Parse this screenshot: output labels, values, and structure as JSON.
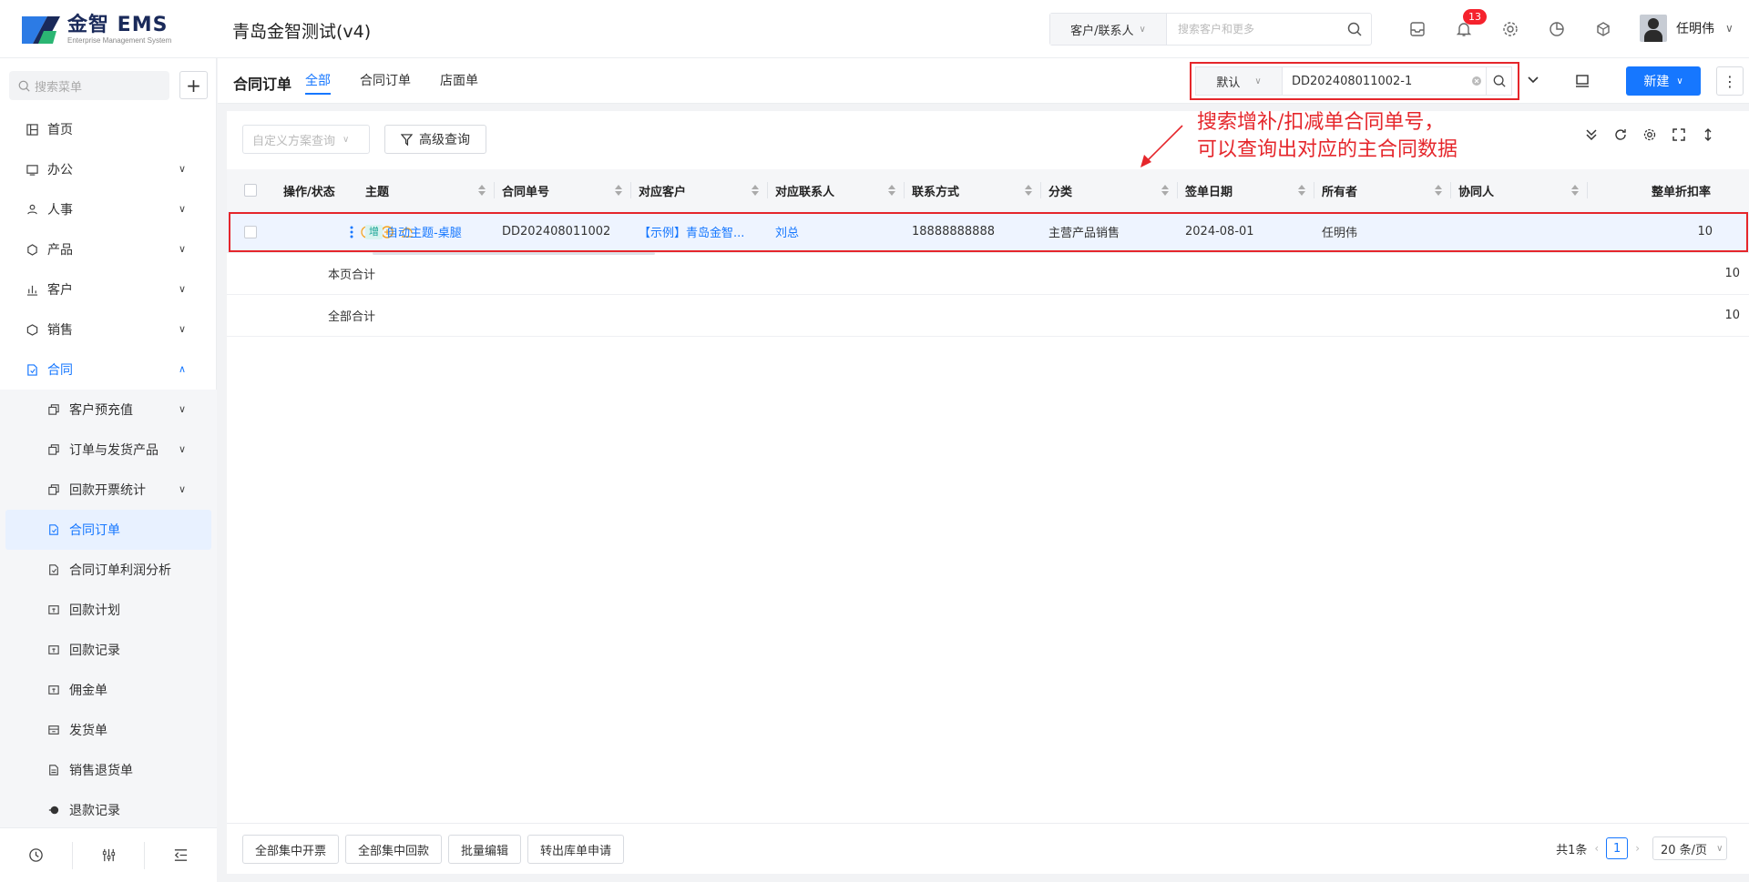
{
  "header": {
    "logo_title": "金智 EMS",
    "logo_subtitle": "Enterprise Management System",
    "app_title": "青岛金智测试(v4)",
    "search_type": "客户/联系人",
    "search_placeholder": "搜索客户和更多",
    "notification_count": "13",
    "user_name": "任明伟"
  },
  "sidebar": {
    "search_placeholder": "搜索菜单",
    "items": [
      {
        "label": "首页",
        "icon": "home-icon"
      },
      {
        "label": "办公",
        "icon": "office-icon"
      },
      {
        "label": "人事",
        "icon": "people-icon"
      },
      {
        "label": "产品",
        "icon": "cube-icon"
      },
      {
        "label": "客户",
        "icon": "chart-icon"
      },
      {
        "label": "销售",
        "icon": "hexagon-icon"
      },
      {
        "label": "合同",
        "icon": "contract-icon"
      }
    ],
    "sub_items": [
      {
        "label": "客户预充值"
      },
      {
        "label": "订单与发货产品"
      },
      {
        "label": "回款开票统计"
      },
      {
        "label": "合同订单"
      },
      {
        "label": "合同订单利润分析"
      },
      {
        "label": "回款计划"
      },
      {
        "label": "回款记录"
      },
      {
        "label": "佣金单"
      },
      {
        "label": "发货单"
      },
      {
        "label": "销售退货单"
      },
      {
        "label": "退款记录"
      }
    ]
  },
  "content": {
    "title": "合同订单",
    "tabs": [
      "全部",
      "合同订单",
      "店面单"
    ],
    "search_scope": "默认",
    "search_value": "DD202408011002-1",
    "new_button": "新建",
    "filter_placeholder": "自定义方案查询",
    "advanced_query": "高级查询",
    "annotation_line1": "搜索增补/扣减单合同单号，",
    "annotation_line2": "可以查询出对应的主合同数据"
  },
  "table": {
    "columns": [
      "操作/状态",
      "主题",
      "合同单号",
      "对应客户",
      "对应联系人",
      "联系方式",
      "分类",
      "签单日期",
      "所有者",
      "协同人",
      "整单折扣率"
    ],
    "row": {
      "tag": "增",
      "subject": "自动主题-桌腿",
      "order_no": "DD202408011002",
      "customer": "【示例】青岛金智...",
      "contact": "刘总",
      "phone": "18888888888",
      "category": "主营产品销售",
      "sign_date": "2024-08-01",
      "owner": "任明伟",
      "collaborator": "",
      "discount": "10"
    },
    "page_total_label": "本页合计",
    "page_total_value": "10",
    "all_total_label": "全部合计",
    "all_total_value": "10"
  },
  "footer": {
    "buttons": [
      "全部集中开票",
      "全部集中回款",
      "批量编辑",
      "转出库单申请"
    ],
    "total": "共1条",
    "page": "1",
    "page_size": "20 条/页"
  },
  "colors": {
    "accent": "#1677ff",
    "annotation": "#e5262b"
  }
}
